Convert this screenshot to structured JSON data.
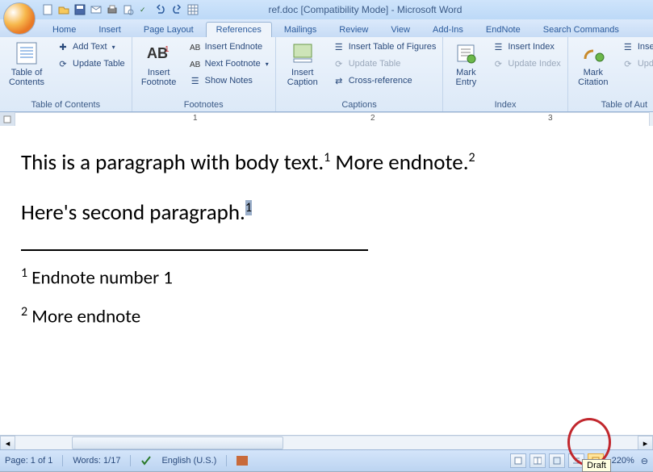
{
  "title": "ref.doc [Compatibility Mode] - Microsoft Word",
  "tabs": [
    "Home",
    "Insert",
    "Page Layout",
    "References",
    "Mailings",
    "Review",
    "View",
    "Add-Ins",
    "EndNote",
    "Search Commands"
  ],
  "active_tab": 3,
  "ribbon": {
    "toc": {
      "big": "Table of\nContents",
      "add_text": "Add Text",
      "update": "Update Table",
      "title": "Table of Contents"
    },
    "footnotes": {
      "big": "Insert\nFootnote",
      "insert_endnote": "Insert Endnote",
      "next_footnote": "Next Footnote",
      "show_notes": "Show Notes",
      "title": "Footnotes"
    },
    "captions": {
      "big": "Insert\nCaption",
      "insert_tof": "Insert Table of Figures",
      "update": "Update Table",
      "crossref": "Cross-reference",
      "title": "Captions"
    },
    "index": {
      "big": "Mark\nEntry",
      "insert_index": "Insert Index",
      "update": "Update Index",
      "title": "Index"
    },
    "toa": {
      "big": "Mark\nCitation",
      "insert_toa": "Insert Ta",
      "update": "Update T",
      "title": "Table of Aut"
    }
  },
  "ruler_numbers": [
    "1",
    "2",
    "3"
  ],
  "document": {
    "p1a": "This is a paragraph with body text.",
    "p1_sup1": "1",
    "p1b": "  More endnote.",
    "p1_sup2": "2",
    "p2": "Here's second paragraph.",
    "p2_sup": "1",
    "en1_num": "1",
    "en1_text": " Endnote number 1",
    "en2_num": "2",
    "en2_text": " More endnote"
  },
  "status": {
    "page": "Page: 1 of 1",
    "words": "Words: 1/17",
    "lang": "English (U.S.)",
    "zoom": "220%",
    "tooltip": "Draft"
  }
}
